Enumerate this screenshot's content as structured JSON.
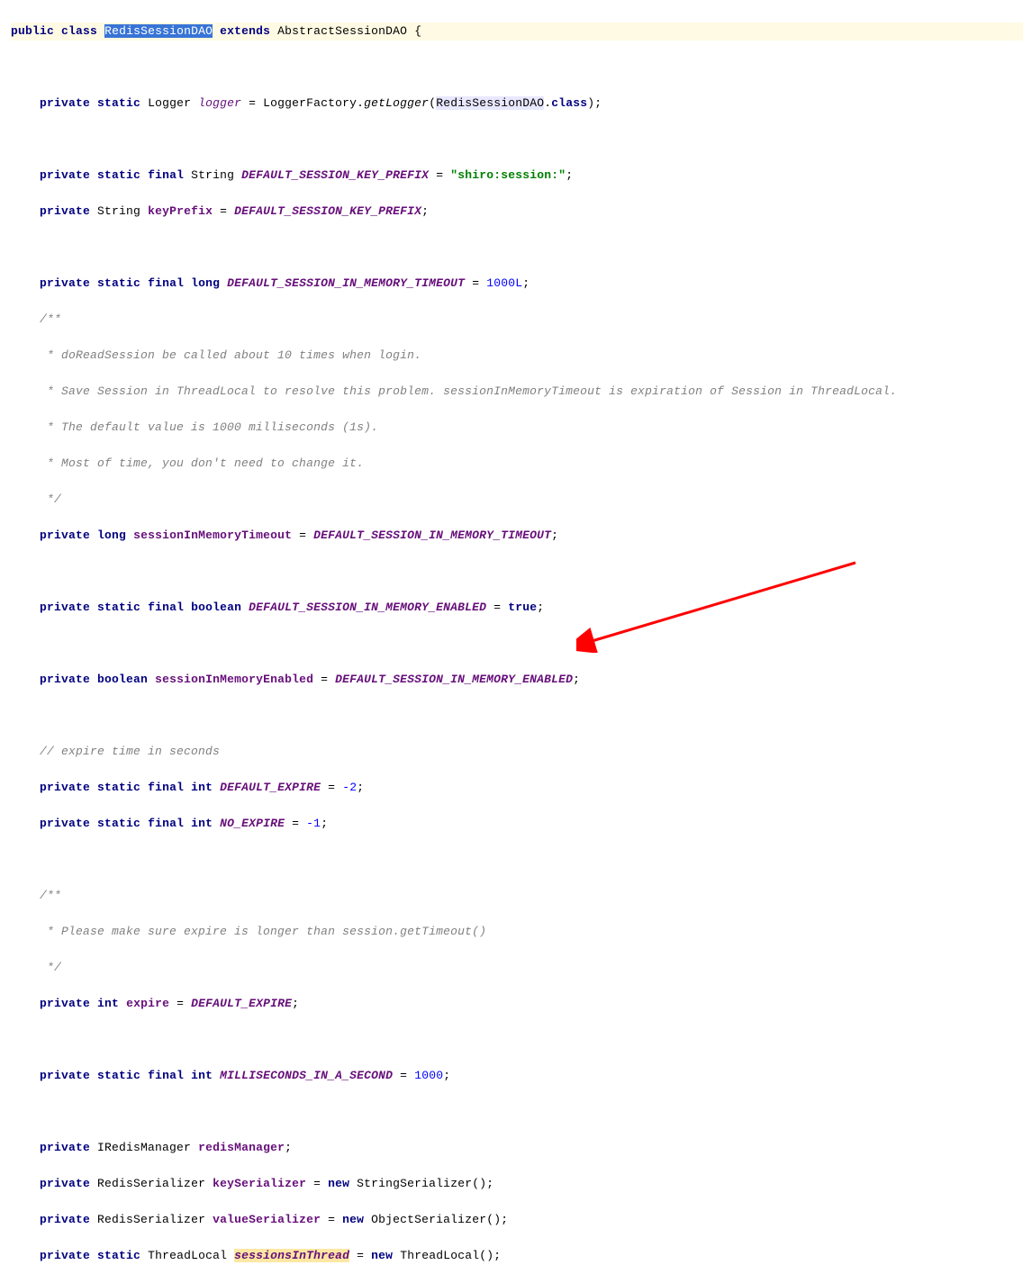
{
  "code": {
    "kw_public": "public",
    "kw_private": "private",
    "kw_static": "static",
    "kw_final": "final",
    "kw_class": "class",
    "kw_extends": "extends",
    "kw_new": "new",
    "kw_true": "true",
    "cls_name": "RedisSessionDAO",
    "super_cls": "AbstractSessionDAO",
    "brace_open": "{",
    "brace_close": "}",
    "semi": ";",
    "eq": " = ",
    "type_Logger": "Logger",
    "type_String": "String",
    "type_long": "long",
    "type_boolean": "boolean",
    "type_int": "int",
    "type_IRedisManager": "IRedisManager",
    "type_RedisSerializer": "RedisSerializer",
    "type_ThreadLocal": "ThreadLocal",
    "fld_logger": "logger",
    "fld_DEFAULT_SESSION_KEY_PREFIX": "DEFAULT_SESSION_KEY_PREFIX",
    "fld_keyPrefix": "keyPrefix",
    "fld_DEFAULT_SESSION_IN_MEMORY_TIMEOUT": "DEFAULT_SESSION_IN_MEMORY_TIMEOUT",
    "fld_sessionInMemoryTimeout": "sessionInMemoryTimeout",
    "fld_DEFAULT_SESSION_IN_MEMORY_ENABLED": "DEFAULT_SESSION_IN_MEMORY_ENABLED",
    "fld_sessionInMemoryEnabled": "sessionInMemoryEnabled",
    "fld_DEFAULT_EXPIRE": "DEFAULT_EXPIRE",
    "fld_NO_EXPIRE": "NO_EXPIRE",
    "fld_expire": "expire",
    "fld_MILLISECONDS_IN_A_SECOND": "MILLISECONDS_IN_A_SECOND",
    "fld_redisManager": "redisManager",
    "fld_keySerializer": "keySerializer",
    "fld_valueSerializer": "valueSerializer",
    "fld_sessionsInThread": "sessionsInThread",
    "expr_getLogger_pre": "LoggerFactory.",
    "expr_getLogger_call": "getLogger",
    "expr_getLogger_arg_pre": "(",
    "expr_getLogger_arg_class": "RedisSessionDAO",
    "expr_getLogger_arg_post": ".",
    "expr_getLogger_class_kw": "class",
    "expr_getLogger_close": ")",
    "str_shiro_session": "\"shiro:session:\"",
    "num_1000L": "1000L",
    "num_neg2": "-2",
    "num_neg1": "-1",
    "num_1000": "1000",
    "ctor_StringSerializer": "StringSerializer()",
    "ctor_ObjectSerializer": "ObjectSerializer()",
    "ctor_ThreadLocal": "ThreadLocal()",
    "cmt_block1_l1": "/**",
    "cmt_block1_l2": " * doReadSession be called about 10 times when login.",
    "cmt_block1_l3": " * Save Session in ThreadLocal to resolve this problem. sessionInMemoryTimeout is expiration of Session in ThreadLocal.",
    "cmt_block1_l4": " * The default value is 1000 milliseconds (1s).",
    "cmt_block1_l5": " * Most of time, you don't need to change it.",
    "cmt_block1_l6": " */",
    "cmt_expire": "// expire time in seconds",
    "cmt_block2_l1": "/**",
    "cmt_block2_l2": " * Please make sure expire is longer than session.getTimeout()",
    "cmt_block2_l3": " */"
  }
}
